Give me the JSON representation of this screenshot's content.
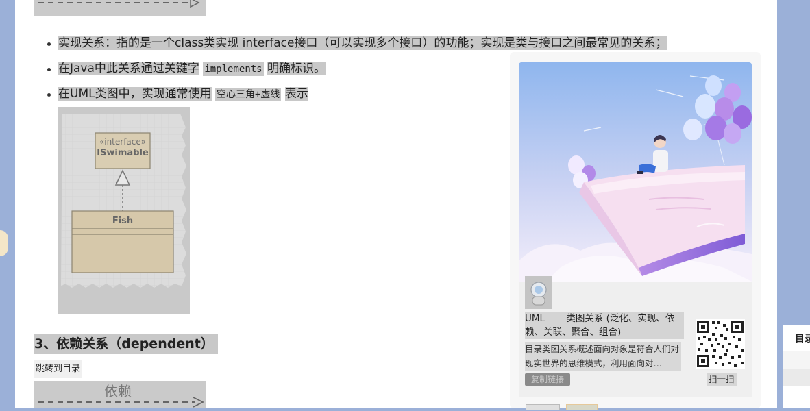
{
  "bullets": [
    {
      "text": "实现关系：指的是一个class类实现 interface接口（可以实现多个接口）的功能；实现是类与接口之间最常见的关系；"
    },
    {
      "pre": "在Java中此关系通过关键字",
      "code": "implements",
      "post": "明确标识。"
    },
    {
      "pre": "在UML类图中，实现通常使用",
      "code": "空心三角+虚线",
      "post": "表示"
    }
  ],
  "uml": {
    "stereotype": "«interface»",
    "interface_name": "ISwimable",
    "class_name": "Fish"
  },
  "section": {
    "heading": "3、依赖关系（dependent）",
    "jump_link": "跳转到目录",
    "diagram_label": "依赖"
  },
  "card": {
    "title": "UML—— 类图关系 (泛化、实现、依赖、关联、聚合、组合)",
    "description": "目录类图关系概述面向对象是符合人们对现实世界的思维模式，利用面向对…",
    "copy_button": "复制链接",
    "scan_label": "扫一扫"
  },
  "toc": {
    "label": "目录"
  },
  "colors": {
    "page_background": "#9bb0d8",
    "highlight": "#c8c8c8"
  }
}
